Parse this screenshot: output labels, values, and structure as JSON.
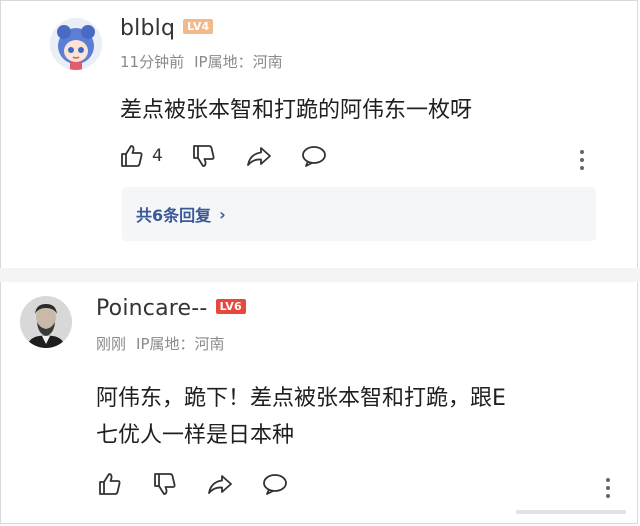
{
  "comments": [
    {
      "username": "blblq",
      "level": "LV4",
      "time": "11分钟前",
      "ip_location": "IP属地：河南",
      "text": "差点被张本智和打跪的阿伟东一枚呀",
      "like_count": "4",
      "reply_summary": "共6条回复",
      "avatar_icon": "anime-avatar-icon"
    },
    {
      "username": "Poincare--",
      "level": "LV6",
      "time": "刚刚",
      "ip_location": "IP属地：河南",
      "text_line1": "阿伟东，跪下！差点被张本智和打跪，跟E",
      "text_line2": "七优人一样是日本种",
      "avatar_icon": "portrait-avatar-icon"
    }
  ],
  "colors": {
    "level4": "#f2b98a",
    "level6": "#e8473e",
    "reply_link": "#3b5998",
    "meta_text": "#8a8a8a"
  }
}
